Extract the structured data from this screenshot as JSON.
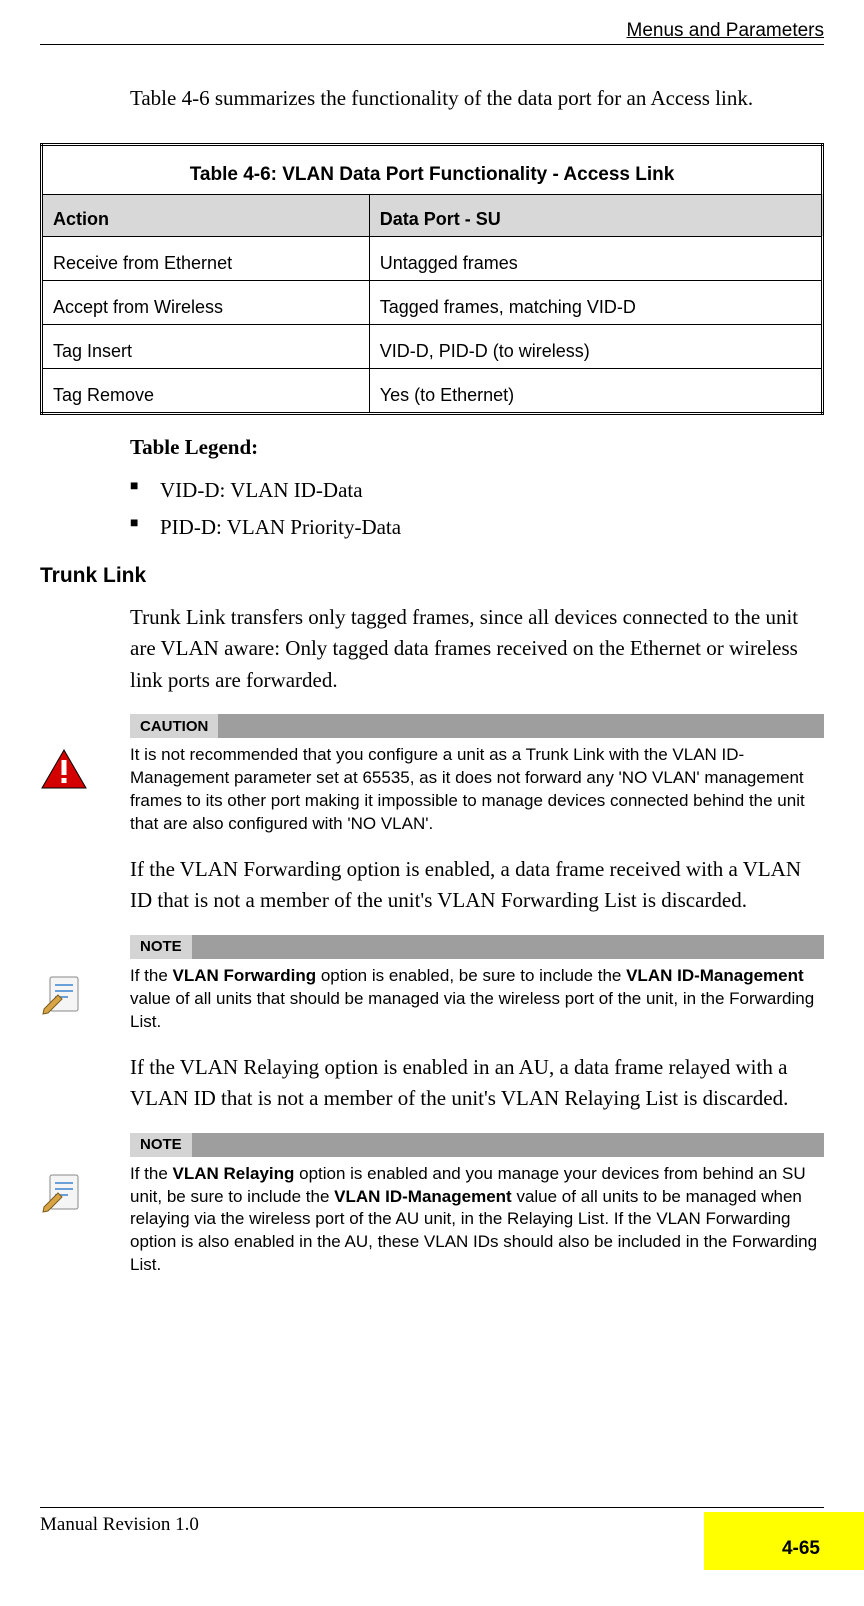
{
  "header": {
    "section": "Menus and Parameters"
  },
  "intro": "Table 4-6 summarizes the functionality of the data port for an Access link.",
  "table": {
    "title": "Table 4-6: VLAN Data Port Functionality - Access Link",
    "headers": {
      "col1": "Action",
      "col2": "Data Port - SU"
    },
    "rows": [
      {
        "action": "Receive from Ethernet",
        "port": "Untagged frames"
      },
      {
        "action": "Accept from Wireless",
        "port": "Tagged frames, matching VID-D"
      },
      {
        "action": "Tag Insert",
        "port": "VID-D, PID-D (to wireless)"
      },
      {
        "action": "Tag Remove",
        "port": "Yes (to Ethernet)"
      }
    ]
  },
  "legend": {
    "title": "Table Legend:",
    "items": [
      "VID-D: VLAN ID-Data",
      "PID-D: VLAN Priority-Data"
    ]
  },
  "trunk": {
    "heading": "Trunk Link",
    "p1": "Trunk Link transfers only tagged frames, since all devices connected to the unit are VLAN aware: Only tagged data frames received on the Ethernet or wireless link ports are forwarded.",
    "p2": "If the VLAN Forwarding option is enabled, a data frame received with a VLAN ID that is not a member of the unit's VLAN Forwarding List is discarded.",
    "p3": "If the VLAN Relaying option is enabled in an AU, a data frame relayed with a VLAN ID that is not a member of the unit's VLAN Relaying List is discarded."
  },
  "caution": {
    "label": "CAUTION",
    "text": "It is not recommended that you configure a unit as a Trunk Link with the VLAN ID-Management parameter set at 65535, as it does not forward any 'NO VLAN' management frames to its other port making it impossible to manage devices connected behind the unit that are also configured with 'NO VLAN'."
  },
  "note1": {
    "label": "NOTE",
    "pre": "If the ",
    "b1": "VLAN Forwarding",
    "mid": " option is enabled, be sure to include the ",
    "b2": "VLAN ID-Management",
    "post": " value of all units that should be managed via the wireless port of the unit, in the Forwarding List."
  },
  "note2": {
    "label": "NOTE",
    "pre": "If the ",
    "b1": "VLAN Relaying",
    "mid": " option is enabled and you manage your devices from behind an SU unit, be sure to include the ",
    "b2": "VLAN ID-Management",
    "post": " value of all units to be managed when relaying via the wireless port of the AU unit, in the Relaying List. If the VLAN Forwarding option is also enabled in the AU, these VLAN IDs should also be included in the Forwarding List."
  },
  "footer": {
    "left": "Manual Revision 1.0",
    "page": "4-65"
  }
}
